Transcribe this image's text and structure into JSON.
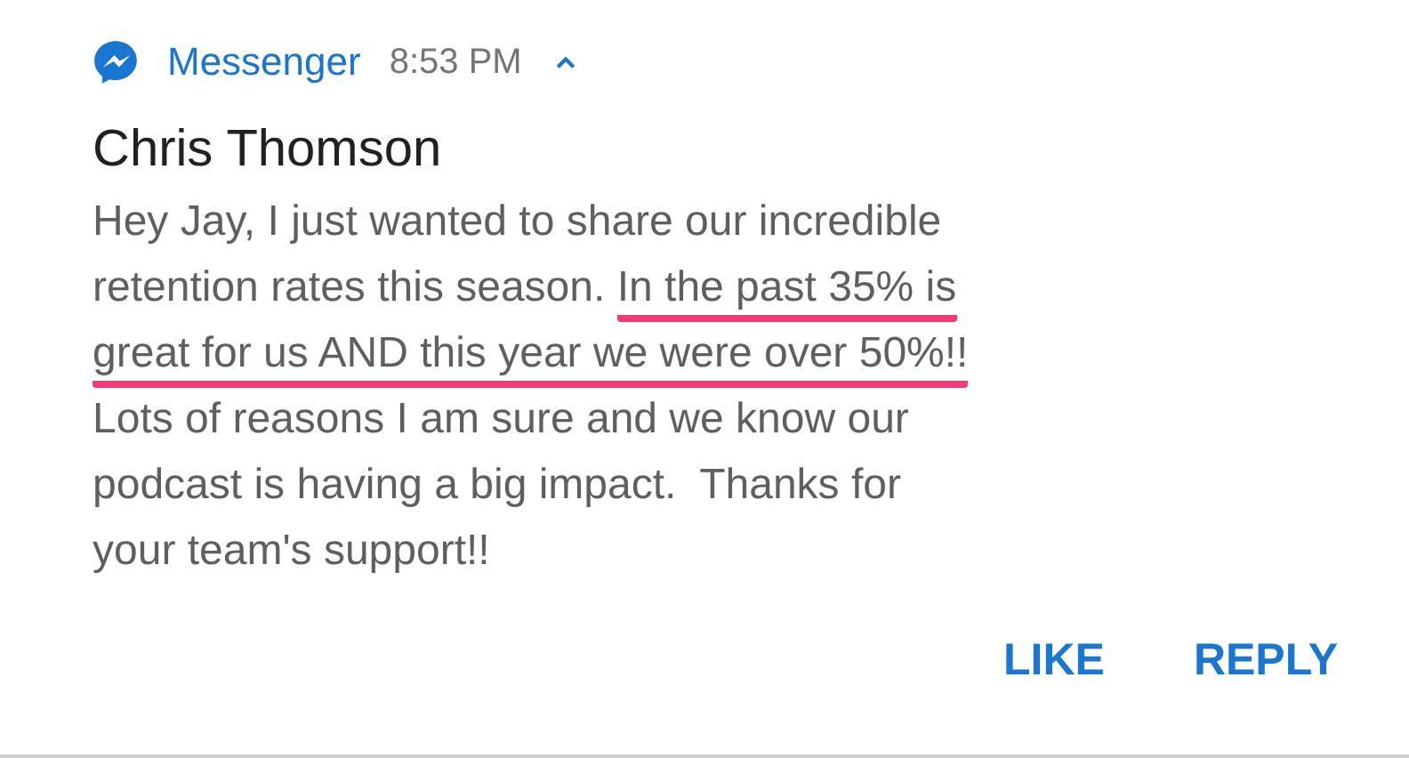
{
  "header": {
    "app_name": "Messenger",
    "time": "8:53 PM",
    "expanded": true
  },
  "sender": "Chris Thomson",
  "message_lines": [
    [
      {
        "text": "Hey Jay, I just wanted to share our incredible",
        "highlighted": false
      }
    ],
    [
      {
        "text": "retention rates this season. ",
        "highlighted": false
      },
      {
        "text": "In the past 35% is",
        "highlighted": true
      }
    ],
    [
      {
        "text": "great for us AND this year we were over 50%!!",
        "highlighted": true
      }
    ],
    [
      {
        "text": "Lots of reasons I am sure and we know our",
        "highlighted": false
      }
    ],
    [
      {
        "text": "podcast is having a big impact.  Thanks for",
        "highlighted": false
      }
    ],
    [
      {
        "text": "your team's support!!",
        "highlighted": false
      }
    ]
  ],
  "actions": [
    "LIKE",
    "REPLY"
  ]
}
